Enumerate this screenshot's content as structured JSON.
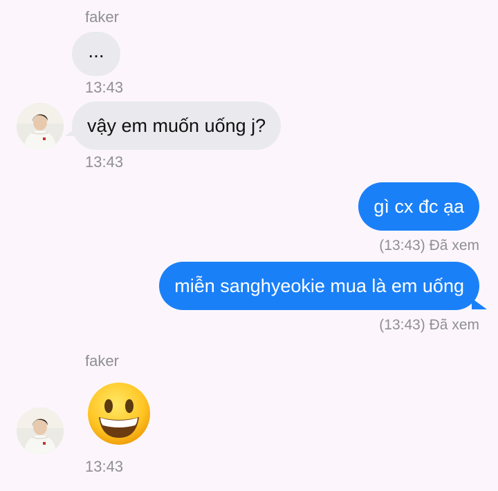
{
  "conversation": {
    "group1": {
      "sender_name": "faker",
      "typing_text": "...",
      "time": "13:43"
    },
    "group2": {
      "message": "vậy em muốn uống j?",
      "time": "13:43"
    },
    "outgoing1": {
      "message": "gì cx đc ạa",
      "status": "(13:43) Đã xem"
    },
    "outgoing2": {
      "message": "miễn sanghyeokie mua là em uống",
      "status": "(13:43) Đã xem"
    },
    "group3": {
      "sender_name": "faker",
      "emoji_name": "grinning-face-emoji",
      "time": "13:43"
    }
  },
  "colors": {
    "background": "#fcf6fc",
    "incoming_bubble": "#e9e9ee",
    "outgoing_bubble": "#1a80f8",
    "meta_text": "#8e8e93"
  }
}
